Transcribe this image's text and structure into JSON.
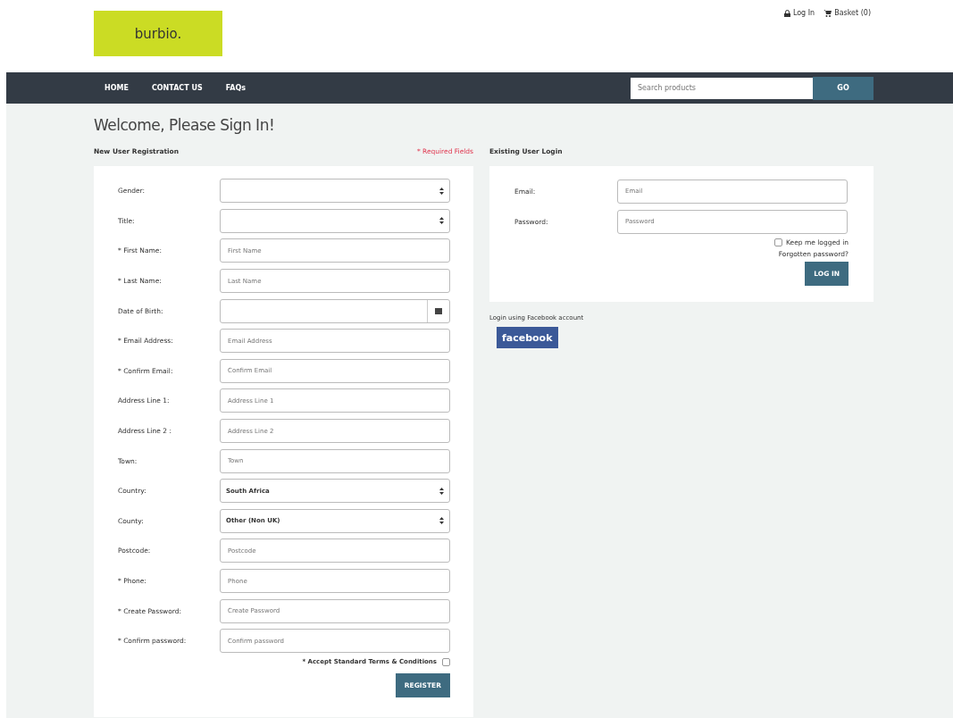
{
  "logo": "burbio.",
  "top_links": [
    {
      "label": "Log In",
      "kind": "lock"
    },
    {
      "label": "Basket (0)",
      "kind": "cart"
    }
  ],
  "nav": [
    "HOME",
    "CONTACT US",
    "FAQs"
  ],
  "search": {
    "placeholder": "Search products",
    "button": "GO"
  },
  "heading": "Welcome, Please Sign In!",
  "registration": {
    "title": "New User Registration",
    "required_note": "* Required Fields",
    "fields": [
      {
        "label": "Gender:",
        "kind": "select"
      },
      {
        "label": "Title:",
        "kind": "select"
      },
      {
        "label": "* First Name:",
        "kind": "text",
        "placeholder": "First Name"
      },
      {
        "label": "* Last Name:",
        "kind": "text",
        "placeholder": "Last Name"
      },
      {
        "label": "Date of Birth:",
        "kind": "date"
      },
      {
        "label": "* Email Address:",
        "kind": "text",
        "placeholder": "Email Address"
      },
      {
        "label": "* Confirm Email:",
        "kind": "text",
        "placeholder": "Confirm Email"
      },
      {
        "label": "Address Line 1:",
        "kind": "text",
        "placeholder": "Address Line 1"
      },
      {
        "label": "Address Line 2 :",
        "kind": "text",
        "placeholder": "Address Line 2"
      },
      {
        "label": "Town:",
        "kind": "text",
        "placeholder": "Town"
      },
      {
        "label": "Country:",
        "kind": "select",
        "value": "South Africa"
      },
      {
        "label": "County:",
        "kind": "select",
        "value": "Other (Non UK)"
      },
      {
        "label": "Postcode:",
        "kind": "text",
        "placeholder": "Postcode"
      },
      {
        "label": "* Phone:",
        "kind": "text",
        "placeholder": "Phone"
      },
      {
        "label": "* Create Password:",
        "kind": "text",
        "placeholder": "Create Password"
      },
      {
        "label": "* Confirm password:",
        "kind": "text",
        "placeholder": "Confirm password"
      }
    ],
    "terms": {
      "label": "* Accept Standard Terms & Conditions",
      "checked": false
    },
    "button": "REGISTER"
  },
  "login": {
    "title": "Existing User Login",
    "fields": [
      {
        "label": "Email:",
        "placeholder": "Email"
      },
      {
        "label": "Password:",
        "placeholder": "Password"
      }
    ],
    "remember": {
      "label": "Keep me logged in",
      "checked": false
    },
    "forgot": "Forgotten password?",
    "button": "LOG IN",
    "facebook_title": "Login using Facebook account",
    "facebook_button": "facebook"
  }
}
